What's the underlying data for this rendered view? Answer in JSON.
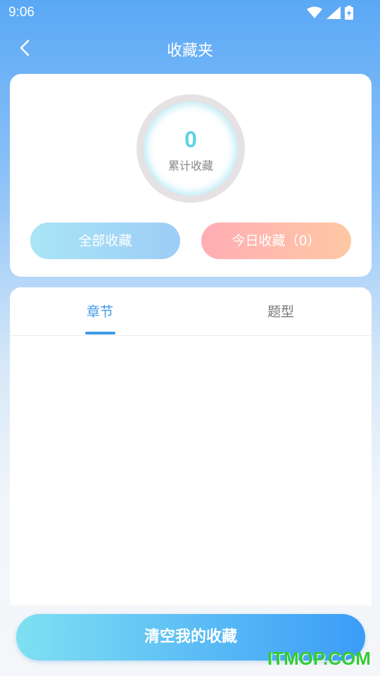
{
  "status_bar": {
    "time": "9:06"
  },
  "nav": {
    "title": "收藏夹"
  },
  "summary": {
    "count": "0",
    "count_label": "累计收藏"
  },
  "buttons": {
    "all": "全部收藏",
    "today": "今日收藏（0）"
  },
  "tabs": [
    {
      "label": "章节",
      "active": true
    },
    {
      "label": "题型",
      "active": false
    }
  ],
  "actions": {
    "clear": "清空我的收藏"
  },
  "watermark": "ITMOP.COM",
  "colors": {
    "accent": "#3d9be8",
    "count": "#5fd3e6",
    "watermark": "#33cc33"
  },
  "icons": {
    "wifi": "wifi-icon",
    "signal": "signal-icon",
    "battery": "battery-icon",
    "back": "chevron-left-icon"
  }
}
